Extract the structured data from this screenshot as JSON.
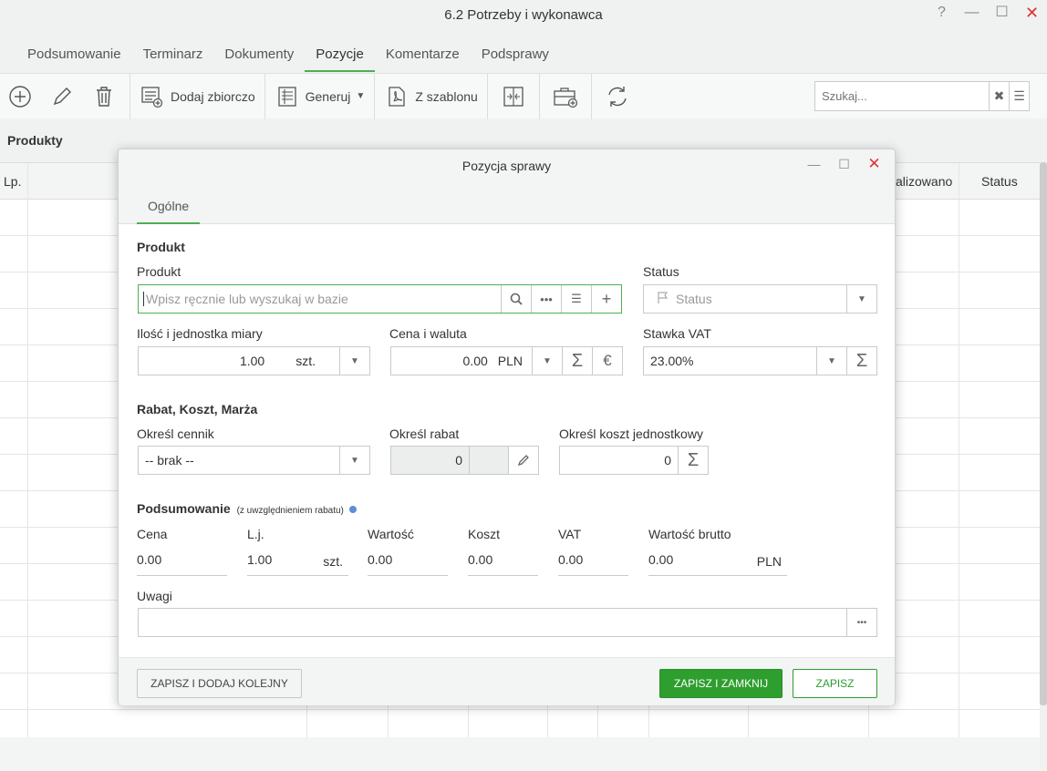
{
  "window": {
    "title": "6.2 Potrzeby i wykonawca",
    "help": "?",
    "minimize": "—",
    "maximize": "☐",
    "close": "✕"
  },
  "tabs": [
    "Podsumowanie",
    "Terminarz",
    "Dokumenty",
    "Pozycje",
    "Komentarze",
    "Podsprawy"
  ],
  "toolbar": {
    "add_bulk": "Dodaj zbiorczo",
    "generate": "Generuj",
    "from_template": "Z szablonu",
    "search_placeholder": "Szukaj..."
  },
  "section_label": "Produkty",
  "grid": {
    "col_lp": "Lp.",
    "col_realized": "alizowano",
    "col_status": "Status"
  },
  "dialog": {
    "title": "Pozycja sprawy",
    "tab": "Ogólne",
    "product_section": "Produkt",
    "product_label": "Produkt",
    "product_placeholder": "Wpisz ręcznie lub wyszukaj w bazie",
    "status_label": "Status",
    "status_placeholder": "Status",
    "qty_label": "Ilość i jednostka miary",
    "qty_value": "1.00",
    "qty_unit": "szt.",
    "price_label": "Cena i waluta",
    "price_value": "0.00",
    "price_currency": "PLN",
    "vat_label": "Stawka VAT",
    "vat_value": "23.00%",
    "discount_section": "Rabat, Koszt, Marża",
    "pricelist_label": "Określ cennik",
    "pricelist_value": "-- brak --",
    "discount_label": "Określ rabat",
    "discount_value": "0",
    "unit_cost_label": "Określ koszt jednostkowy",
    "unit_cost_value": "0",
    "summary_section": "Podsumowanie",
    "summary_note": "(z uwzględnieniem rabatu)",
    "summary": {
      "price_label": "Cena",
      "price_value": "0.00",
      "qty_label": "L.j.",
      "qty_value": "1.00",
      "qty_unit": "szt.",
      "value_label": "Wartość",
      "value_value": "0.00",
      "cost_label": "Koszt",
      "cost_value": "0.00",
      "vat_label": "VAT",
      "vat_value": "0.00",
      "gross_label": "Wartość brutto",
      "gross_value": "0.00",
      "gross_currency": "PLN"
    },
    "notes_label": "Uwagi",
    "btn_save_add": "ZAPISZ I DODAJ KOLEJNY",
    "btn_save_close": "ZAPISZ I ZAMKNIJ",
    "btn_save": "ZAPISZ"
  },
  "colors": {
    "accent": "#4caf50",
    "primary_button": "#2e9e2e",
    "close": "#dd3333"
  }
}
